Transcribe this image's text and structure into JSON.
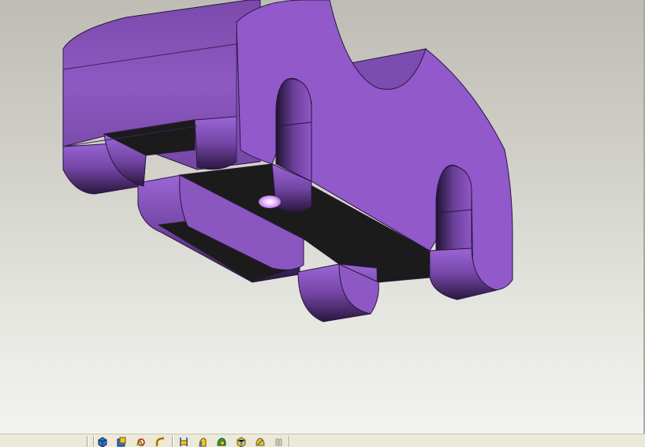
{
  "viewport": {
    "background_top": "#bdbdb5",
    "background_bottom": "#f3f3ef",
    "model_color": "#9159c9",
    "model_dark": "#3a2156",
    "cavity_color": "#1a1a1a"
  },
  "toolbar": {
    "buttons": [
      {
        "icon": "shaded-cube-icon"
      },
      {
        "icon": "extrude-icon"
      },
      {
        "icon": "rotate-view-icon"
      },
      {
        "icon": "sweep-icon"
      },
      {
        "icon": "datum-plane-icon"
      },
      {
        "icon": "revolve-icon"
      },
      {
        "icon": "shell-icon"
      },
      {
        "icon": "cut-cube-icon"
      },
      {
        "icon": "surface-icon"
      },
      {
        "icon": "disabled-tool-icon"
      }
    ]
  }
}
